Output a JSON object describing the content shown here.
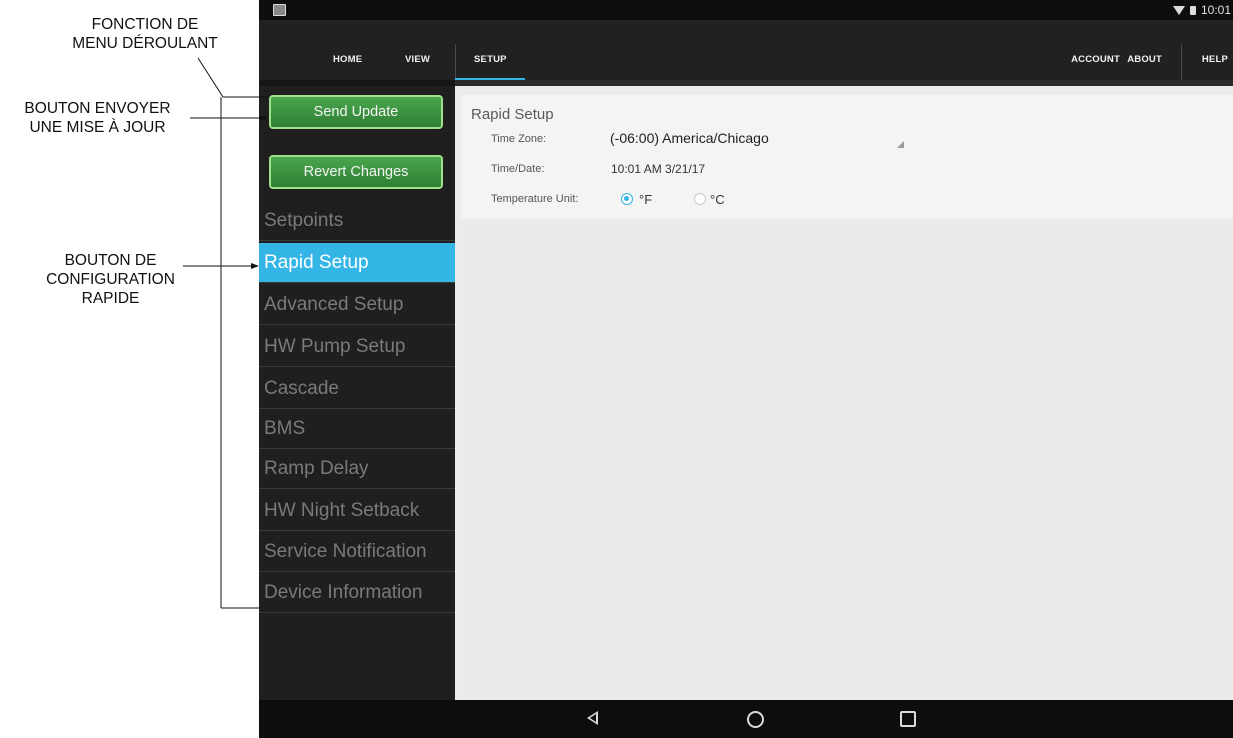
{
  "annotations": {
    "dropdown_function": [
      "FONCTION DE",
      "MENU DÉROULANT"
    ],
    "send_update_button": [
      "BOUTON ENVOYER",
      "UNE MISE À JOUR"
    ],
    "rapid_setup_button": [
      "BOUTON DE",
      "CONFIGURATION",
      "RAPIDE"
    ]
  },
  "status_bar": {
    "time": "10:01"
  },
  "top_nav": {
    "left": [
      "HOME",
      "VIEW",
      "SETUP"
    ],
    "right": [
      "ACCOUNT",
      "ABOUT",
      "HELP"
    ],
    "active": "SETUP"
  },
  "sidebar": {
    "send_update": "Send Update",
    "revert_changes": "Revert Changes",
    "items": [
      {
        "label": "Setpoints"
      },
      {
        "label": "Rapid Setup",
        "selected": true
      },
      {
        "label": "Advanced Setup"
      },
      {
        "label": "HW Pump Setup"
      },
      {
        "label": "Cascade"
      },
      {
        "label": "BMS"
      },
      {
        "label": "Ramp Delay"
      },
      {
        "label": "HW Night Setback"
      },
      {
        "label": "Service Notification"
      },
      {
        "label": "Device Information"
      }
    ]
  },
  "rapid_setup": {
    "title": "Rapid Setup",
    "time_zone_label": "Time Zone:",
    "time_zone_value": "(-06:00) America/Chicago",
    "date_label": "Time/Date:",
    "date_value": "10:01 AM  3/21/17",
    "temperature_unit_label": "Temperature Unit:",
    "unit_f": "°F",
    "unit_c": "°C",
    "selected_unit": "F"
  },
  "colors": {
    "accent": "#33b5e5",
    "button_green": "#3c9442",
    "sidebar_bg": "#1f1f1f"
  },
  "icons": [
    "app-icon",
    "wifi-icon",
    "battery-icon",
    "back-icon",
    "home-icon",
    "recents-icon",
    "dropdown-arrow-icon"
  ]
}
